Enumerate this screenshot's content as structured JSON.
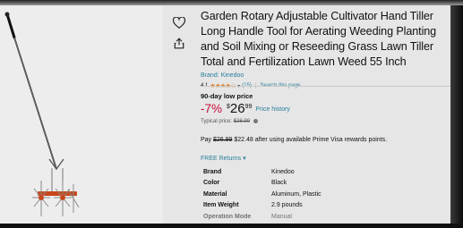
{
  "product": {
    "title": "Garden Rotary Adjustable Cultivator Hand Tiller Long Handle Tool for Aerating Weeding Planting and Soil Mixing or Reseeding Grass Lawn Tiller Total and Fertilization Lawn Weed 55 Inch",
    "brand_link": "Brand: Kinedoo",
    "rating_value": "4.1",
    "stars": "★★★★☆",
    "rating_count": "(15)",
    "search_link": "Search this page"
  },
  "pricing": {
    "deal_label": "90-day low price",
    "discount": "-7%",
    "currency": "$",
    "price_whole": "26",
    "price_fraction": "99",
    "price_history": "Price history",
    "typical_label": "Typical price:",
    "typical_price": "$28.99"
  },
  "visa": {
    "pay": "Pay",
    "old_price": "$26.99",
    "rest": "$22.48 after using available Prime Visa rewards points."
  },
  "returns": {
    "label": "FREE Returns"
  },
  "specs": [
    {
      "key": "Brand",
      "value": "Kinedoo"
    },
    {
      "key": "Color",
      "value": "Black"
    },
    {
      "key": "Material",
      "value": "Aluminum, Plastic"
    },
    {
      "key": "Item Weight",
      "value": "2.9 pounds"
    },
    {
      "key": "Operation Mode",
      "value": "Manual"
    }
  ],
  "icons": {
    "wishlist": "heart-icon",
    "share": "share-icon"
  },
  "colors": {
    "link": "#2a7f9a",
    "discount": "#cc0c39",
    "stars": "#de7921"
  }
}
